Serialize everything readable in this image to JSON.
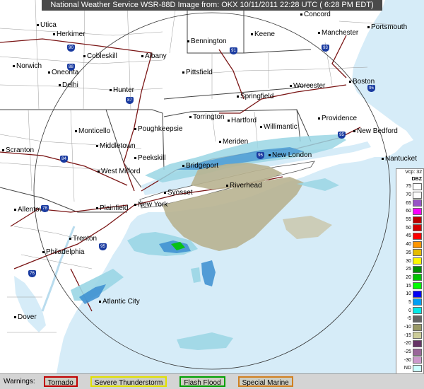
{
  "header": {
    "title": "National Weather Service WSR-88D Image from: OKX 10/11/2011  22:28 UTC  ( 6:28 PM EDT)"
  },
  "cities": [
    {
      "name": "Utica",
      "key": "utica"
    },
    {
      "name": "Herkimer",
      "key": "herkimer"
    },
    {
      "name": "Concord",
      "key": "concord"
    },
    {
      "name": "Portsmouth",
      "key": "portsmouth"
    },
    {
      "name": "Bennington",
      "key": "bennington"
    },
    {
      "name": "Keene",
      "key": "keene"
    },
    {
      "name": "Manchester",
      "key": "manchester"
    },
    {
      "name": "Cobleskill",
      "key": "cobleskill"
    },
    {
      "name": "Albany",
      "key": "albany"
    },
    {
      "name": "Norwich",
      "key": "norwich"
    },
    {
      "name": "Oneonta",
      "key": "oneonta"
    },
    {
      "name": "Pittsfield",
      "key": "pittsfield"
    },
    {
      "name": "Delhi",
      "key": "delhi"
    },
    {
      "name": "Worcester",
      "key": "worcester"
    },
    {
      "name": "Boston",
      "key": "boston"
    },
    {
      "name": "Hunter",
      "key": "hunter"
    },
    {
      "name": "Springfield",
      "key": "springfield"
    },
    {
      "name": "Torrington",
      "key": "torrington"
    },
    {
      "name": "Hartford",
      "key": "hartford"
    },
    {
      "name": "Providence",
      "key": "providence"
    },
    {
      "name": "Willimantic",
      "key": "willimantic"
    },
    {
      "name": "Monticello",
      "key": "monticello"
    },
    {
      "name": "Poughkeepsie",
      "key": "poughkeepsie"
    },
    {
      "name": "New Bedford",
      "key": "new-bedford"
    },
    {
      "name": "Middletown",
      "key": "middletown"
    },
    {
      "name": "Meriden",
      "key": "meriden"
    },
    {
      "name": "Scranton",
      "key": "scranton"
    },
    {
      "name": "Peekskill",
      "key": "peekskill"
    },
    {
      "name": "New London",
      "key": "new-london"
    },
    {
      "name": "Nantucket",
      "key": "nantucket"
    },
    {
      "name": "Bridgeport",
      "key": "bridgeport"
    },
    {
      "name": "West Milford",
      "key": "west-milford"
    },
    {
      "name": "Riverhead",
      "key": "riverhead"
    },
    {
      "name": "Syosset",
      "key": "syosset"
    },
    {
      "name": "Allentown",
      "key": "allentown"
    },
    {
      "name": "Plainfield",
      "key": "plainfield"
    },
    {
      "name": "New York",
      "key": "new-york"
    },
    {
      "name": "Trenton",
      "key": "trenton"
    },
    {
      "name": "Philadelphia",
      "key": "philadelphia"
    },
    {
      "name": "Atlantic City",
      "key": "atlantic-city"
    },
    {
      "name": "Dover",
      "key": "dover"
    }
  ],
  "shields": [
    "90",
    "88",
    "91",
    "93",
    "87",
    "84",
    "95",
    "95",
    "76",
    "95",
    "78",
    "95"
  ],
  "legend": {
    "title": "Vcp: 32",
    "unit": "DBZ",
    "entries": [
      {
        "label": "75",
        "color": "#ffffff"
      },
      {
        "label": "70",
        "color": "#fdfdfd"
      },
      {
        "label": "65",
        "color": "#9854c6"
      },
      {
        "label": "60",
        "color": "#f800fd"
      },
      {
        "label": "55",
        "color": "#bc0000"
      },
      {
        "label": "50",
        "color": "#d40000"
      },
      {
        "label": "45",
        "color": "#fd0000"
      },
      {
        "label": "40",
        "color": "#fd9500"
      },
      {
        "label": "35",
        "color": "#e5bc00"
      },
      {
        "label": "30",
        "color": "#fdf802"
      },
      {
        "label": "25",
        "color": "#008e00"
      },
      {
        "label": "20",
        "color": "#01c501"
      },
      {
        "label": "15",
        "color": "#02fd02"
      },
      {
        "label": "10",
        "color": "#0300f4"
      },
      {
        "label": "5",
        "color": "#019ff4"
      },
      {
        "label": "0",
        "color": "#04e9e7"
      },
      {
        "label": "-5",
        "color": "#646464"
      },
      {
        "label": "-10",
        "color": "#999966"
      },
      {
        "label": "-15",
        "color": "#cccc99"
      },
      {
        "label": "-20",
        "color": "#663366"
      },
      {
        "label": "-25",
        "color": "#996699"
      },
      {
        "label": "-30",
        "color": "#cc99cc"
      },
      {
        "label": "ND",
        "color": "#ccffff"
      }
    ]
  },
  "footer": {
    "warnings_label": "Warnings:",
    "tornado": "Tornado",
    "severe": "Severe Thunderstorm",
    "flood": "Flash Flood",
    "marine": "Special Marine"
  },
  "colors": {
    "land": "#ffffff",
    "water": "#d6ecf8",
    "state_border": "#444444",
    "county_border": "#999999",
    "highway": "#7a1515",
    "range_ring": "#333333",
    "radar_light": "#9ad6e4",
    "radar_blue": "#3b8ed0",
    "radar_gray": "#b8b390"
  }
}
